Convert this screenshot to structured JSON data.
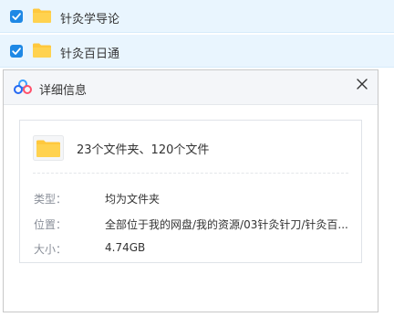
{
  "file_list": {
    "rows": [
      {
        "name": "针灸学导论",
        "checked": true
      },
      {
        "name": "针灸百日通",
        "checked": true
      }
    ]
  },
  "details_dialog": {
    "title": "详细信息",
    "summary": "23个文件夹、120个文件",
    "properties": {
      "type": {
        "label": "类型：",
        "value": "均为文件夹"
      },
      "location": {
        "label": "位置：",
        "value": "全部位于我的网盘/我的资源/03针灸针刀/针灸百..."
      },
      "size": {
        "label": "大小：",
        "value": "4.74GB"
      }
    }
  },
  "icons": {
    "checkbox": "checkbox-checked-icon",
    "folder": "folder-icon",
    "app": "cloud-logo-icon",
    "close": "close-icon"
  },
  "colors": {
    "selected_row_bg": "#e9f5fe",
    "checkbox_blue": "#1e88e5",
    "folder_yellow": "#ffc83d",
    "label_gray": "#8a8f99"
  }
}
